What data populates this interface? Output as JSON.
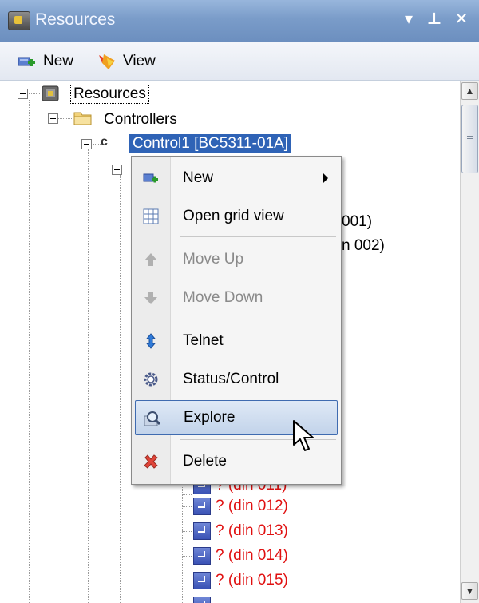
{
  "panel": {
    "title": "Resources",
    "dropdown_glyph": "▾",
    "pin_glyph": "⊥",
    "close_glyph": "✕"
  },
  "toolbar": {
    "new_label": "New",
    "view_label": "View"
  },
  "tree": {
    "root_label": "Resources",
    "controllers_label": "Controllers",
    "controller_label": "Control1 [BC5311-01A]",
    "controller_badge": "c",
    "partial_1": "001)",
    "partial_2": "n 002)",
    "partial_3": "? (din 011)",
    "din_items": [
      "? (din 012)",
      "? (din 013)",
      "? (din 014)",
      "? (din 015)"
    ]
  },
  "context_menu": {
    "items": [
      {
        "label": "New",
        "icon": "new-icon",
        "enabled": true,
        "submenu": true
      },
      {
        "label": "Open grid view",
        "icon": "grid-icon",
        "enabled": true
      },
      {
        "label": "Move Up",
        "icon": "arrow-up-icon",
        "enabled": false
      },
      {
        "label": "Move Down",
        "icon": "arrow-down-icon",
        "enabled": false
      },
      {
        "label": "Telnet",
        "icon": "telnet-icon",
        "enabled": true
      },
      {
        "label": "Status/Control",
        "icon": "gear-icon",
        "enabled": true
      },
      {
        "label": "Explore",
        "icon": "explore-icon",
        "enabled": true,
        "hovered": true
      },
      {
        "label": "Delete",
        "icon": "delete-icon",
        "enabled": true
      }
    ]
  },
  "colors": {
    "selection": "#2f63b6",
    "error_text": "#e01010",
    "menu_hover_border": "#3f6bb0"
  }
}
